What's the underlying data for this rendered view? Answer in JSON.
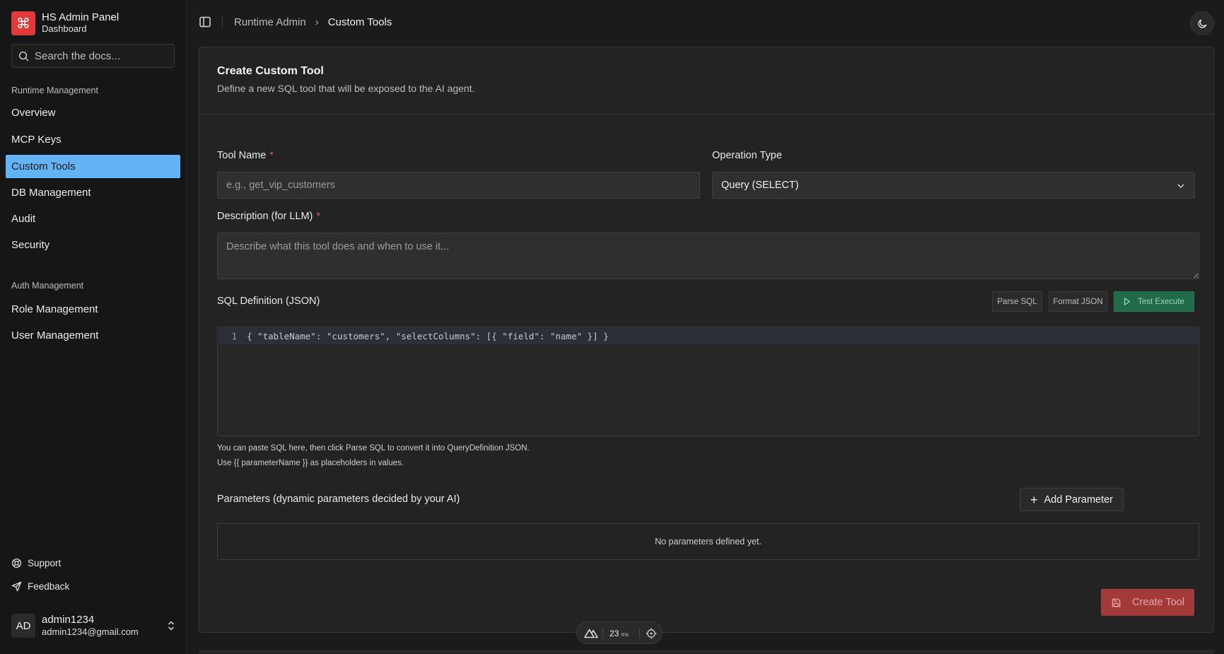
{
  "brand": {
    "logo_glyph": "⌘",
    "title": "HS Admin Panel",
    "subtitle": "Dashboard",
    "accent": "#e03a3a"
  },
  "search": {
    "placeholder": "Search the docs..."
  },
  "sidebar": {
    "section_runtime": "Runtime Management",
    "runtime_items": [
      {
        "label": "Overview"
      },
      {
        "label": "MCP Keys"
      },
      {
        "label": "Custom Tools",
        "active": true
      },
      {
        "label": "DB Management"
      },
      {
        "label": "Audit"
      },
      {
        "label": "Security"
      }
    ],
    "section_auth": "Auth Management",
    "auth_items": [
      {
        "label": "Role Management"
      },
      {
        "label": "User Management"
      }
    ],
    "active_color": "#63b3f7",
    "support": "Support",
    "feedback": "Feedback"
  },
  "user": {
    "initials": "AD",
    "name": "admin1234",
    "email": "admin1234@gmail.com"
  },
  "breadcrumb": {
    "root": "Runtime Admin",
    "separator": "›",
    "current": "Custom Tools"
  },
  "form": {
    "title": "Create Custom Tool",
    "description": "Define a new SQL tool that will be exposed to the AI agent.",
    "tool_name_label": "Tool Name",
    "required_mark": "*",
    "tool_name_placeholder": "e.g., get_vip_customers",
    "operation_label": "Operation Type",
    "operation_value": "Query (SELECT)",
    "description_label": "Description (for LLM)",
    "description_placeholder": "Describe what this tool does and when to use it...",
    "sql_label": "SQL Definition (JSON)",
    "parse_sql": "Parse SQL",
    "format_json": "Format JSON",
    "test_execute": "Test Execute",
    "editor_line_no": "1",
    "editor_code": "{ \"tableName\": \"customers\", \"selectColumns\": [{ \"field\": \"name\" }] }",
    "hint_1": "You can paste SQL here, then click Parse SQL to convert it into QueryDefinition JSON.",
    "hint_2": "Use {{ parameterName }} as placeholders in values.",
    "params_label": "Parameters (dynamic parameters decided by your AI)",
    "add_parameter": "Add Parameter",
    "empty_params": "No parameters defined yet.",
    "create_button": "Create Tool"
  },
  "devtools": {
    "ms_value": "23",
    "ms_unit": "ms"
  }
}
